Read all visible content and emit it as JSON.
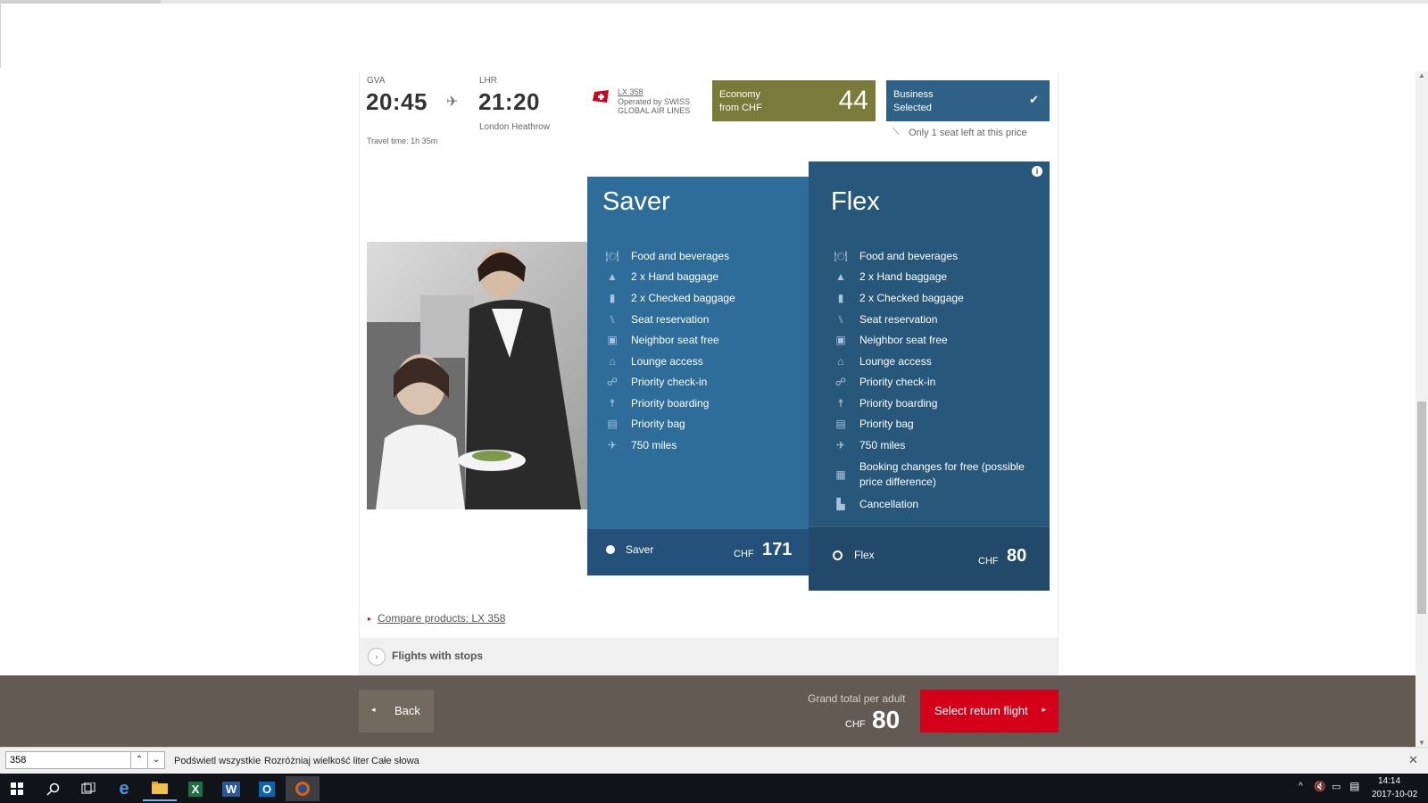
{
  "flight": {
    "departure": {
      "code": "GVA",
      "time": "20:45"
    },
    "arrival": {
      "code": "LHR",
      "time": "21:20",
      "airport": "London Heathrow"
    },
    "travel_time": "Travel time: 1h 35m",
    "flight_number": "LX 358",
    "operated_line1": "Operated by SWISS",
    "operated_line2": "GLOBAL AIR LINES"
  },
  "fares": {
    "economy": {
      "line1": "Economy",
      "line2": "from CHF",
      "price": "44"
    },
    "business": {
      "line1": "Business",
      "line2": "Selected"
    },
    "seat_notice": "Only 1 seat left at this price"
  },
  "products": {
    "saver": {
      "title": "Saver",
      "features": [
        {
          "icon": "fork-knife-icon",
          "label": "Food and beverages"
        },
        {
          "icon": "hand-baggage-icon",
          "label": "2 x Hand baggage"
        },
        {
          "icon": "checked-baggage-icon",
          "label": "2 x Checked baggage"
        },
        {
          "icon": "seat-icon",
          "label": "Seat reservation"
        },
        {
          "icon": "neighbor-seat-icon",
          "label": "Neighbor seat free"
        },
        {
          "icon": "lounge-icon",
          "label": "Lounge access"
        },
        {
          "icon": "priority-checkin-icon",
          "label": "Priority check-in"
        },
        {
          "icon": "priority-boarding-icon",
          "label": "Priority boarding"
        },
        {
          "icon": "priority-bag-icon",
          "label": "Priority bag"
        },
        {
          "icon": "miles-icon",
          "label": "750 miles"
        }
      ],
      "footer_label": "Saver",
      "currency": "CHF",
      "price": "171"
    },
    "flex": {
      "title": "Flex",
      "features": [
        {
          "icon": "fork-knife-icon",
          "label": "Food and beverages"
        },
        {
          "icon": "hand-baggage-icon",
          "label": "2 x Hand baggage"
        },
        {
          "icon": "checked-baggage-icon",
          "label": "2 x Checked baggage"
        },
        {
          "icon": "seat-icon",
          "label": "Seat reservation"
        },
        {
          "icon": "neighbor-seat-icon",
          "label": "Neighbor seat free"
        },
        {
          "icon": "lounge-icon",
          "label": "Lounge access"
        },
        {
          "icon": "priority-checkin-icon",
          "label": "Priority check-in"
        },
        {
          "icon": "priority-boarding-icon",
          "label": "Priority boarding"
        },
        {
          "icon": "priority-bag-icon",
          "label": "Priority bag"
        },
        {
          "icon": "miles-icon",
          "label": "750 miles"
        },
        {
          "icon": "calendar-icon",
          "label": "Booking changes for free (possible price difference)"
        },
        {
          "icon": "cancellation-icon",
          "label": "Cancellation"
        }
      ],
      "footer_label": "Flex",
      "currency": "CHF",
      "price": "80"
    }
  },
  "compare_link": "Compare products: LX 358",
  "flights_with_stops": "Flights with stops",
  "bottom": {
    "back": "Back",
    "grand_total_label": "Grand total per adult",
    "currency": "CHF",
    "total": "80",
    "select_button": "Select return flight"
  },
  "findbar": {
    "query": "358",
    "highlight_all": "Podświetl wszystkie",
    "match_case": "Rozróżniaj wielkość liter",
    "whole_words": "Całe słowa"
  },
  "taskbar": {
    "time": "14:14",
    "date": "2017-10-02"
  },
  "colors": {
    "saver_blue": "#2e6d99",
    "flex_blue": "#28577c",
    "economy_olive": "#7a7a3a",
    "business_blue": "#2f6187",
    "swiss_red": "#d4001a",
    "bottom_bar": "#625a53"
  }
}
